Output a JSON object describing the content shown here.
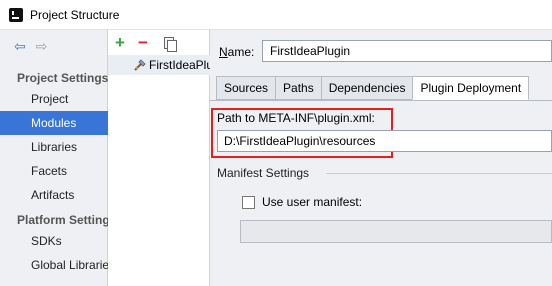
{
  "window": {
    "title": "Project Structure"
  },
  "sidebar": {
    "sections": [
      {
        "title": "Project Settings",
        "items": [
          "Project",
          "Modules",
          "Libraries",
          "Facets",
          "Artifacts"
        ]
      },
      {
        "title": "Platform Settings",
        "items": [
          "SDKs",
          "Global Libraries"
        ]
      }
    ],
    "selected": "Modules"
  },
  "modules_toolbar": {
    "add": "+",
    "remove": "−"
  },
  "modules": [
    {
      "label": "FirstIdeaPlugin"
    }
  ],
  "detail": {
    "name_label_prefix": "N",
    "name_label_rest": "ame:",
    "name_value": "FirstIdeaPlugin",
    "tabs": [
      "Sources",
      "Paths",
      "Dependencies",
      "Plugin Deployment"
    ],
    "active_tab": "Plugin Deployment",
    "path_label": "Path to  META-INF\\plugin.xml:",
    "path_value": "D:\\FirstIdeaPlugin\\resources",
    "manifest_section": "Manifest Settings",
    "use_manifest_label": "Use user manifest:",
    "use_manifest_checked": false,
    "manifest_path": ""
  },
  "colors": {
    "selection": "#3875d7",
    "highlight_border": "#e32020",
    "add": "#3aa43a",
    "remove": "#dd2233"
  }
}
